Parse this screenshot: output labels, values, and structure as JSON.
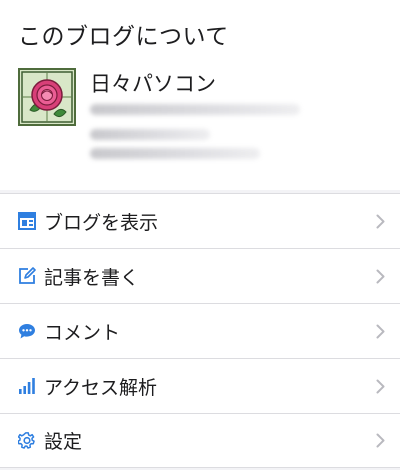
{
  "header": {
    "title": "このブログについて"
  },
  "profile": {
    "blog_name": "日々パソコン",
    "avatar_icon": "rose-stained-glass-icon"
  },
  "menu": {
    "items": [
      {
        "label": "ブログを表示",
        "icon": "blog-layout-icon"
      },
      {
        "label": "記事を書く",
        "icon": "edit-pencil-icon"
      },
      {
        "label": "コメント",
        "icon": "comment-bubble-icon"
      },
      {
        "label": "アクセス解析",
        "icon": "bar-chart-icon"
      },
      {
        "label": "設定",
        "icon": "gear-icon"
      }
    ]
  },
  "colors": {
    "accent": "#2f7fe0",
    "background": "#f3f3f6",
    "divider": "#dcdce0",
    "chevron": "#b9b9bf"
  }
}
